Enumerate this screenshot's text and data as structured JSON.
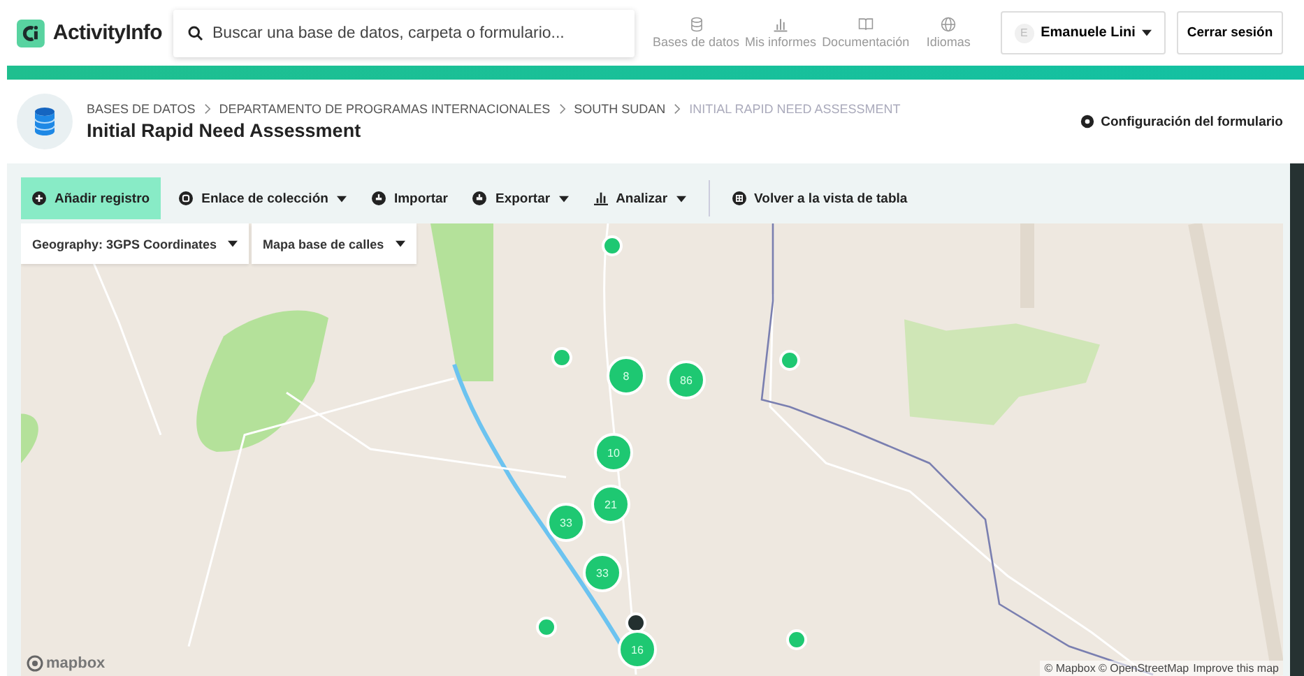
{
  "header": {
    "logo_text": "ActivityInfo",
    "search": {
      "placeholder": "Buscar una base de datos, carpeta o formulario..."
    },
    "nav": [
      {
        "label": "Bases de datos",
        "kind": "database"
      },
      {
        "label": "Mis informes",
        "kind": "chart"
      },
      {
        "label": "Documentación",
        "kind": "book"
      },
      {
        "label": "Idiomas",
        "kind": "globe"
      }
    ],
    "user": {
      "initial": "E",
      "name": "Emanuele Lini"
    },
    "logout": "Cerrar sesión"
  },
  "page": {
    "breadcrumbs": [
      {
        "label": "BASES DE DATOS",
        "current": false
      },
      {
        "label": "DEPARTAMENTO DE PROGRAMAS INTERNACIONALES",
        "current": false
      },
      {
        "label": "SOUTH SUDAN",
        "current": false
      },
      {
        "label": "INITIAL RAPID NEED ASSESSMENT",
        "current": true
      }
    ],
    "title": "Initial Rapid Need Assessment",
    "settings_link": "Configuración del formulario"
  },
  "toolbar": [
    {
      "label": "Añadir registro",
      "kind": "primary",
      "dropdown": false
    },
    {
      "label": "Enlace de colección",
      "kind": "plain",
      "dropdown": true
    },
    {
      "label": "Importar",
      "kind": "plain",
      "dropdown": false
    },
    {
      "label": "Exportar",
      "kind": "plain",
      "dropdown": true
    },
    {
      "label": "Analizar",
      "kind": "plain",
      "dropdown": true
    },
    {
      "label": "Volver a la vista de tabla",
      "kind": "separated",
      "dropdown": false
    }
  ],
  "map": {
    "controls": [
      {
        "label": "Geography: 3GPS Coordinates"
      },
      {
        "label": "Mapa base de calles"
      }
    ],
    "markers": [
      {
        "kind": "point"
      },
      {
        "kind": "point"
      },
      {
        "kind": "cluster",
        "count": "8"
      },
      {
        "kind": "cluster",
        "count": "86"
      },
      {
        "kind": "point"
      },
      {
        "kind": "cluster",
        "count": "10"
      },
      {
        "kind": "cluster",
        "count": "21"
      },
      {
        "kind": "cluster",
        "count": "33"
      },
      {
        "kind": "cluster",
        "count": "33"
      },
      {
        "kind": "highlighted"
      },
      {
        "kind": "point"
      },
      {
        "kind": "cluster",
        "count": "16"
      },
      {
        "kind": "point"
      }
    ],
    "logo": "mapbox",
    "attribution": "© Mapbox © OpenStreetMap",
    "improve_link": "Improve this map"
  }
}
